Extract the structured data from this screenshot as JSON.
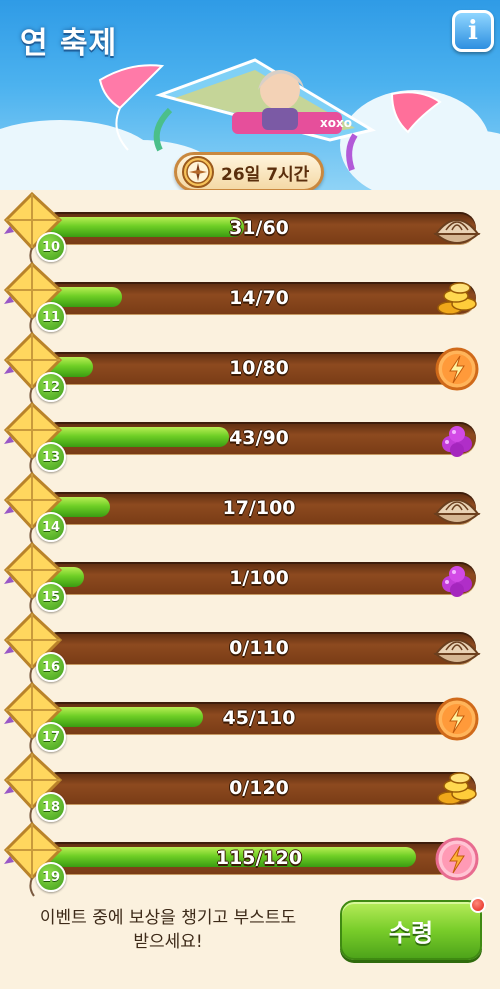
{
  "header": {
    "title": "연 축제",
    "info_label": "i",
    "timer": "26일 7시간"
  },
  "rows": [
    {
      "level": "10",
      "progress_text": "31/60",
      "current": 31,
      "goal": 60,
      "reward_icon": "clam-shell-icon"
    },
    {
      "level": "11",
      "progress_text": "14/70",
      "current": 14,
      "goal": 70,
      "reward_icon": "gold-coins-icon"
    },
    {
      "level": "12",
      "progress_text": "10/80",
      "current": 10,
      "goal": 80,
      "reward_icon": "lightning-booster-icon"
    },
    {
      "level": "13",
      "progress_text": "43/90",
      "current": 43,
      "goal": 90,
      "reward_icon": "purple-berries-icon"
    },
    {
      "level": "14",
      "progress_text": "17/100",
      "current": 17,
      "goal": 100,
      "reward_icon": "clam-shell-icon"
    },
    {
      "level": "15",
      "progress_text": "1/100",
      "current": 1,
      "goal": 100,
      "reward_icon": "purple-berries-icon"
    },
    {
      "level": "16",
      "progress_text": "0/110",
      "current": 0,
      "goal": 110,
      "reward_icon": "clam-shell-icon"
    },
    {
      "level": "17",
      "progress_text": "45/110",
      "current": 45,
      "goal": 110,
      "reward_icon": "lightning-booster-icon"
    },
    {
      "level": "18",
      "progress_text": "0/120",
      "current": 0,
      "goal": 120,
      "reward_icon": "gold-coins-icon"
    },
    {
      "level": "19",
      "progress_text": "115/120",
      "current": 115,
      "goal": 120,
      "reward_icon": "pink-lightning-booster-icon"
    }
  ],
  "footer": {
    "message_line1": "이벤트 중에 보상을 챙기고 부스트도",
    "message_line2": "받으세요!",
    "claim_label": "수령"
  },
  "colors": {
    "progress_fill": "#6fcf26",
    "track": "#7a3c16",
    "claim_button": "#79cd2a",
    "sky": "#4cb2ef"
  }
}
